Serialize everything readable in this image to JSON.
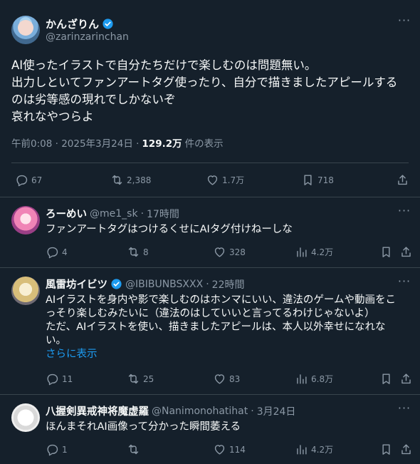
{
  "main_tweet": {
    "display_name": "かんざりん",
    "handle": "@zarinzarinchan",
    "text_lines": [
      "AI使ったイラストで自分たちだけで楽しむのは問題無い。",
      "出力しといてファンアートタグ使ったり、自分で描きましたアピールする",
      "のは劣等感の現れでしかないぞ",
      "哀れなやつらよ"
    ],
    "timestamp": "午前0:08 · 2025年3月24日 ·",
    "views": "129.2万",
    "views_label": "件の表示",
    "replies": "67",
    "reposts": "2,388",
    "likes": "1.7万",
    "bookmarks": "718"
  },
  "replies": [
    {
      "display_name": "ろーめい",
      "handle": "@me1_sk",
      "dot": "·",
      "time": "17時間",
      "verified": false,
      "text_lines": [
        "ファンアートタグはつけるくせにAIタグ付けねーしな"
      ],
      "show_more": "",
      "replies": "4",
      "reposts": "8",
      "likes": "328",
      "views": "4.2万"
    },
    {
      "display_name": "風雷坊イビツ",
      "handle": "@IBIBUNBSXXX",
      "dot": "·",
      "time": "22時間",
      "verified": true,
      "text_lines": [
        "AIイラストを身内や影で楽しむのはホンマにいい、違法のゲームや動画をこ",
        "っそり楽しむみたいに（違法のはしていいと言ってるわけじゃないよ）",
        "ただ、AIイラストを使い、描きましたアピールは、本人以外幸せになれな",
        "い。"
      ],
      "show_more": "さらに表示",
      "replies": "11",
      "reposts": "25",
      "likes": "83",
      "views": "6.8万"
    },
    {
      "display_name": "八握剣異戒神将魔虚羅",
      "handle": "@Nanimonohatihat",
      "dot": "·",
      "time": "3月24日",
      "verified": false,
      "text_lines": [
        "ほんまそれAI画像って分かった瞬間萎える"
      ],
      "show_more": "",
      "replies": "1",
      "reposts": "",
      "likes": "114",
      "views": "4.2万"
    }
  ],
  "icons": {
    "more": "more-icon",
    "verified": "verified-badge-icon",
    "reply": "reply-icon",
    "repost": "repost-icon",
    "like": "like-icon",
    "views": "views-icon",
    "bookmark": "bookmark-icon",
    "share": "share-icon"
  },
  "colors": {
    "background": "#15202b",
    "text": "#f7f9f9",
    "secondary": "#8b98a5",
    "accent": "#1d9bf0",
    "border": "#38444d"
  }
}
